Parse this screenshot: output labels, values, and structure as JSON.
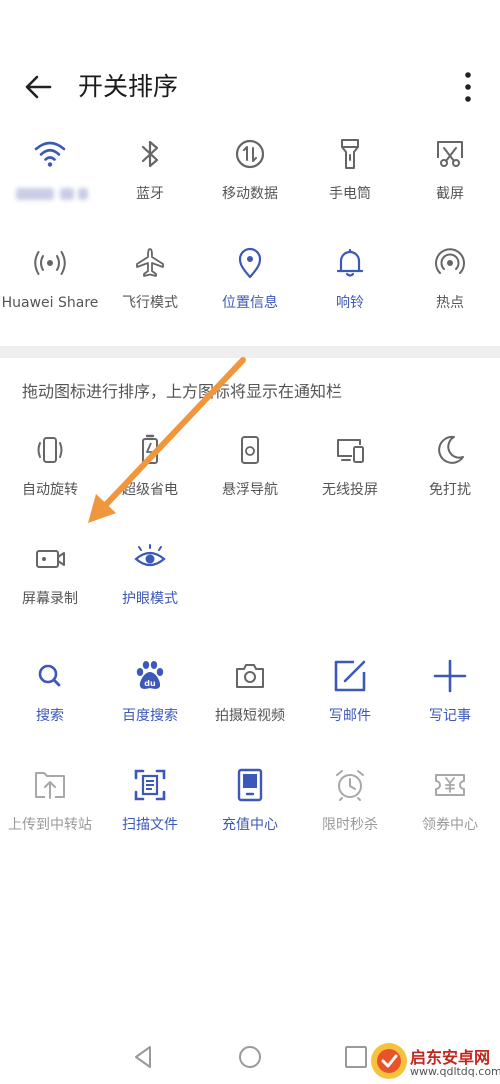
{
  "header": {
    "title": "开关排序"
  },
  "active_tiles": [
    {
      "name": "wifi",
      "label": "",
      "icon": "wifi-icon",
      "style": "blue"
    },
    {
      "name": "bluetooth",
      "label": "蓝牙",
      "icon": "bluetooth-icon",
      "style": "gray"
    },
    {
      "name": "mobile-data",
      "label": "移动数据",
      "icon": "mobile-data-icon",
      "style": "gray"
    },
    {
      "name": "flashlight",
      "label": "手电筒",
      "icon": "flashlight-icon",
      "style": "gray"
    },
    {
      "name": "screenshot",
      "label": "截屏",
      "icon": "screenshot-icon",
      "style": "gray"
    },
    {
      "name": "huawei-share",
      "label": "Huawei Share",
      "icon": "huawei-share-icon",
      "style": "gray"
    },
    {
      "name": "airplane",
      "label": "飞行模式",
      "icon": "airplane-icon",
      "style": "gray"
    },
    {
      "name": "location",
      "label": "位置信息",
      "icon": "location-icon",
      "style": "blue"
    },
    {
      "name": "ring",
      "label": "响铃",
      "icon": "bell-icon",
      "style": "blue"
    },
    {
      "name": "hotspot",
      "label": "热点",
      "icon": "hotspot-icon",
      "style": "gray"
    }
  ],
  "hint": "拖动图标进行排序，上方图标将显示在通知栏",
  "more_tiles": [
    {
      "name": "auto-rotate",
      "label": "自动旋转",
      "icon": "rotate-icon",
      "style": "gray"
    },
    {
      "name": "power-saver",
      "label": "超级省电",
      "icon": "battery-saver-icon",
      "style": "gray"
    },
    {
      "name": "floating-nav",
      "label": "悬浮导航",
      "icon": "floating-nav-icon",
      "style": "gray"
    },
    {
      "name": "wireless-projection",
      "label": "无线投屏",
      "icon": "projection-icon",
      "style": "gray"
    },
    {
      "name": "do-not-disturb",
      "label": "免打扰",
      "icon": "moon-icon",
      "style": "gray"
    },
    {
      "name": "screen-record",
      "label": "屏幕录制",
      "icon": "screen-record-icon",
      "style": "gray"
    },
    {
      "name": "eye-comfort",
      "label": "护眼模式",
      "icon": "eye-icon",
      "style": "blue"
    }
  ],
  "shortcut_tiles": [
    {
      "name": "search",
      "label": "搜索",
      "icon": "search-icon",
      "style": "blue"
    },
    {
      "name": "baidu-search",
      "label": "百度搜索",
      "icon": "baidu-paw-icon",
      "style": "blue"
    },
    {
      "name": "short-video",
      "label": "拍摄短视频",
      "icon": "camera-icon",
      "style": "gray"
    },
    {
      "name": "write-email",
      "label": "写邮件",
      "icon": "compose-icon",
      "style": "blue"
    },
    {
      "name": "write-note",
      "label": "写记事",
      "icon": "plus-icon",
      "style": "blue"
    },
    {
      "name": "upload-transfer",
      "label": "上传到中转站",
      "icon": "upload-icon",
      "style": "light"
    },
    {
      "name": "scan-document",
      "label": "扫描文件",
      "icon": "scan-icon",
      "style": "blue"
    },
    {
      "name": "recharge-center",
      "label": "充值中心",
      "icon": "recharge-icon",
      "style": "blue"
    },
    {
      "name": "flash-sale",
      "label": "限时秒杀",
      "icon": "alarm-clock-icon",
      "style": "light"
    },
    {
      "name": "coupon-center",
      "label": "领券中心",
      "icon": "coupon-icon",
      "style": "light"
    }
  ],
  "watermark": {
    "title": "启东安卓网",
    "url": "www.qdltdq.com"
  },
  "colors": {
    "blue": "#3c58b8",
    "gray": "#666666",
    "light": "#a8a8a8",
    "arrow": "#f0963c"
  }
}
